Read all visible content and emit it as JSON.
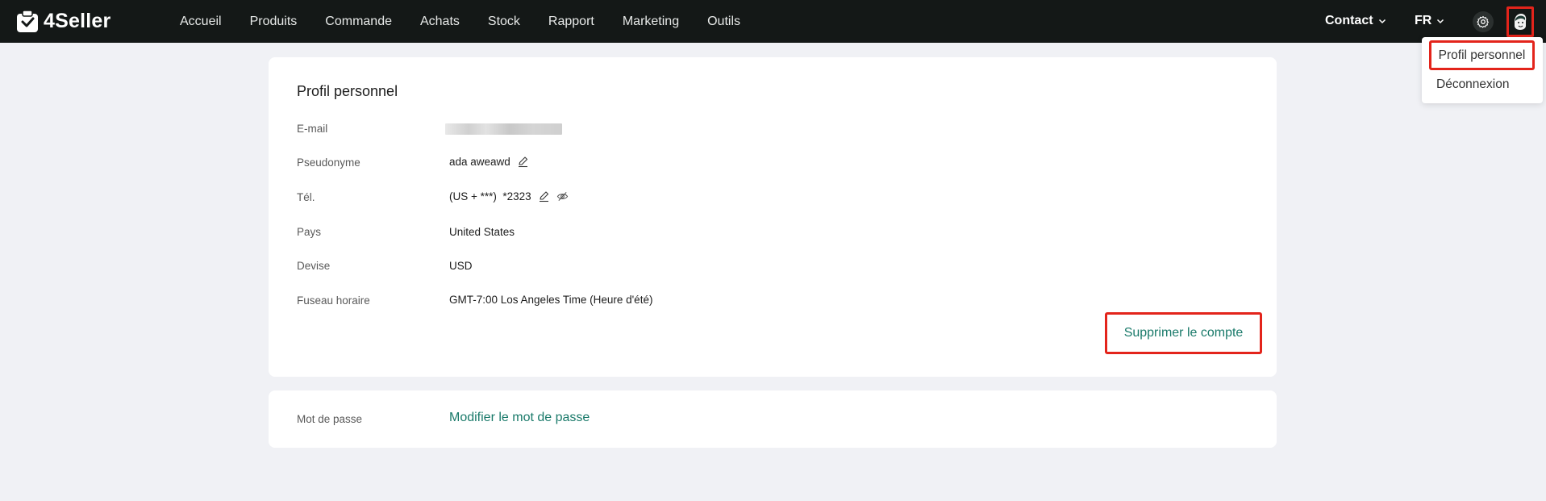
{
  "app": {
    "brand": "4Seller"
  },
  "nav": {
    "items": [
      "Accueil",
      "Produits",
      "Commande",
      "Achats",
      "Stock",
      "Rapport",
      "Marketing",
      "Outils"
    ]
  },
  "header_right": {
    "contact_label": "Contact",
    "language_label": "FR",
    "settings_icon": "gear-icon",
    "avatar_icon": "avatar-icon"
  },
  "user_menu": {
    "profile_label": "Profil personnel",
    "logout_label": "Déconnexion"
  },
  "profile": {
    "title": "Profil personnel",
    "rows": [
      {
        "label": "E-mail",
        "value": ""
      },
      {
        "label": "Pseudonyme",
        "value": "ada aweawd"
      },
      {
        "label": "Tél.",
        "value": "(US + ***)  *2323"
      },
      {
        "label": "Pays",
        "value": "United States"
      },
      {
        "label": "Devise",
        "value": "USD"
      },
      {
        "label": "Fuseau horaire",
        "value": "GMT-7:00 Los Angeles Time (Heure d'été)"
      }
    ],
    "delete_label": "Supprimer le compte"
  },
  "password": {
    "label": "Mot de passe",
    "link_label": "Modifier le mot de passe"
  },
  "colors": {
    "topbar": "#141817",
    "accent_link": "#1a7a6a",
    "highlight": "#e3241b",
    "page_bg": "#f0f1f5"
  }
}
